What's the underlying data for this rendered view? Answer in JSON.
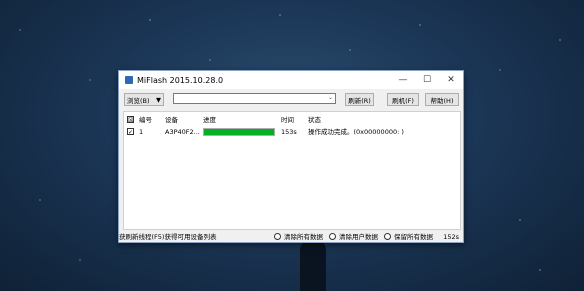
{
  "window": {
    "title": "MiFlash 2015.10.28.0"
  },
  "titlebar": {
    "minimize": "—",
    "maximize": "☐",
    "close": "✕"
  },
  "toolbar": {
    "browse_label": "浏览(B)",
    "browse_arrow": "▼",
    "path_value": "",
    "path_arrow": "⌄",
    "refresh_label": "刷新(R)",
    "flash_label": "刷机(F)",
    "help_label": "帮助(H)"
  },
  "table": {
    "header_check": "☒",
    "columns": [
      "编号",
      "设备",
      "进度",
      "时间",
      "状态"
    ],
    "rows": [
      {
        "checked": "✓",
        "id": "1",
        "device": "A3P40F2...",
        "progress": 1.0,
        "time": "153s",
        "status": "操作成功完成。(0x00000000: )"
      }
    ]
  },
  "statusbar": {
    "text": "获刷新线程(F5)获得可用设备列表",
    "option1": "清除所有数据",
    "option2": "清除用户数据",
    "option3": "保留所有数据",
    "elapsed": "152s"
  },
  "colors": {
    "progress": "#06b025",
    "border": "#8aa4c8"
  }
}
